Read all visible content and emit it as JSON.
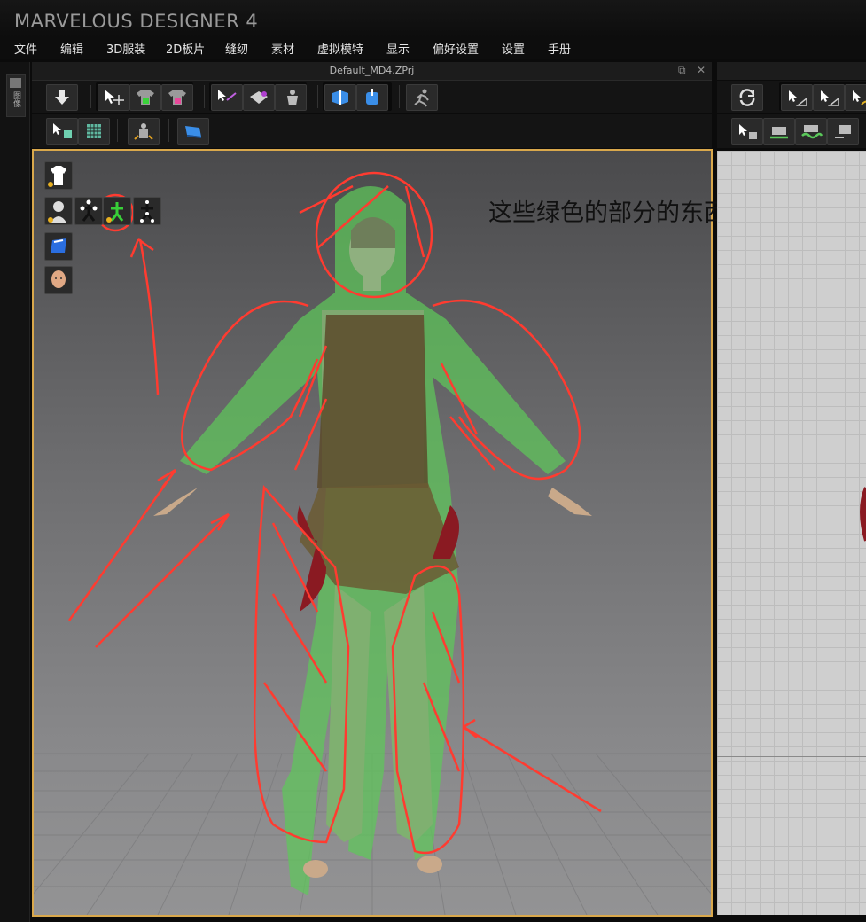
{
  "app": {
    "title": "MARVELOUS DESIGNER 4"
  },
  "menu": [
    "文件",
    "编辑",
    "3D服装",
    "2D板片",
    "缝纫",
    "素材",
    "虚拟模特",
    "显示",
    "偏好设置",
    "设置",
    "手册"
  ],
  "side_panel": {
    "label": "图像"
  },
  "window": {
    "title": "Default_MD4.ZPrj",
    "restore_glyph": "⧉",
    "close_glyph": "✕"
  },
  "toolbar": {
    "row1": [
      "arrow-down-icon",
      "select-move-icon",
      "garment-green-icon",
      "garment-pink-icon",
      "pin-icon",
      "brush-icon",
      "avatar-pose-icon",
      "stretch-blue-icon",
      "pack-blue-icon",
      "run-icon"
    ],
    "row2": [
      "select-mesh-icon",
      "texture-icon",
      "avatar-measure-icon",
      "flat-panel-icon"
    ]
  },
  "viewport_icons": [
    "garment-icon",
    "avatar-icon",
    "skeleton-black-icon",
    "skeleton-green-icon",
    "skeleton-white-icon",
    "panel-blue-icon",
    "avatar-head-icon"
  ],
  "annotation": {
    "text": "这些绿色的部分的东西"
  },
  "colors": {
    "accent_border": "#d9a84c",
    "annotation_red": "#ff3b30",
    "overlay_green": "#5ec85a"
  }
}
